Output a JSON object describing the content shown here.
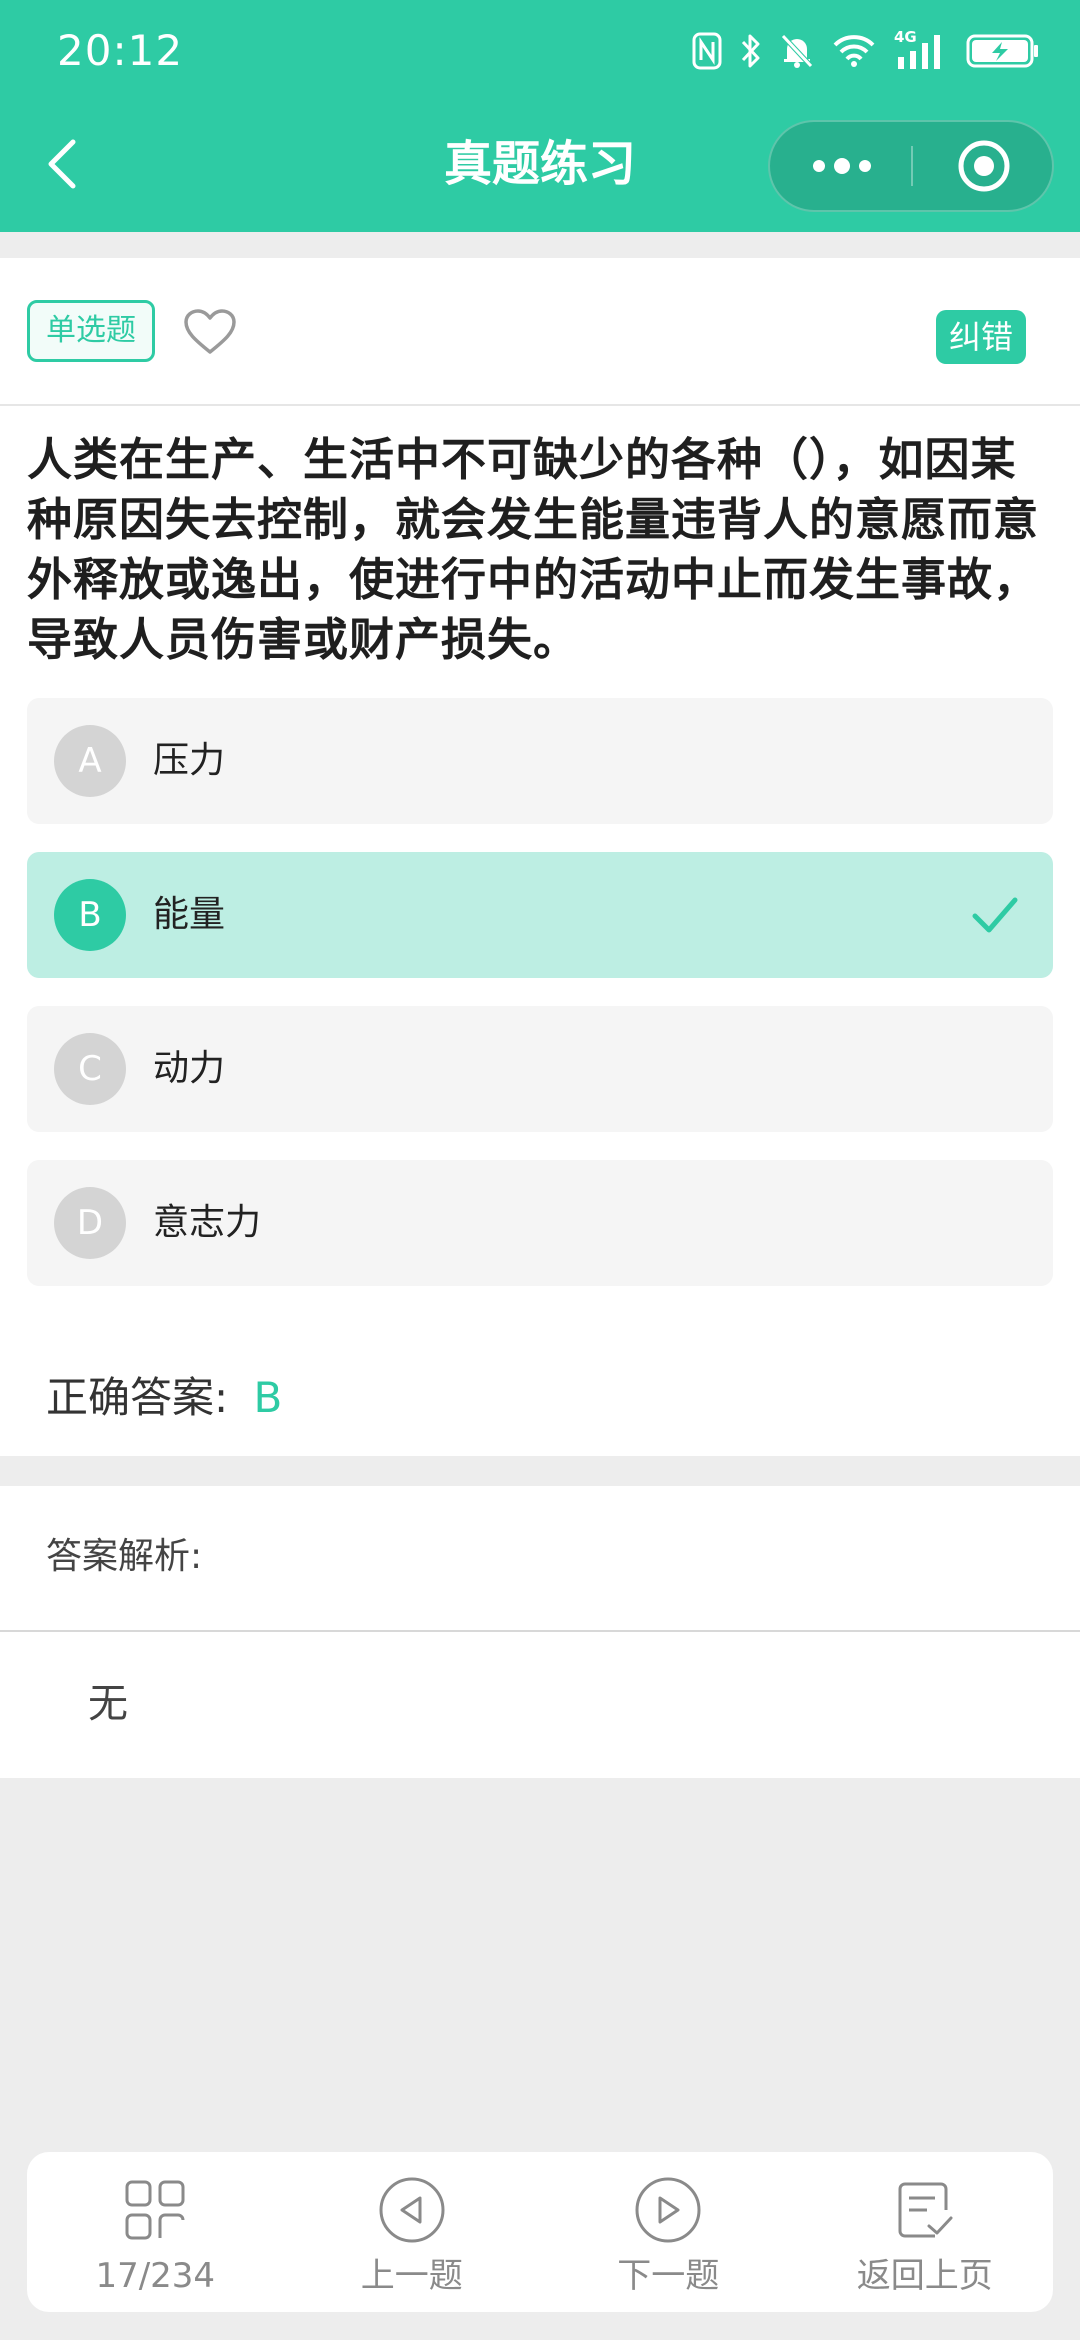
{
  "status_bar": {
    "time": "20:12",
    "icons": [
      "nfc-icon",
      "bluetooth-icon",
      "bell-off-icon",
      "wifi-icon",
      "4g-signal-icon",
      "battery-charging-icon"
    ],
    "network_label": "4G"
  },
  "nav": {
    "title": "真题练习",
    "back_icon": "chevron-left-icon",
    "more_icon": "more-dots-icon",
    "close_icon": "target-circle-icon"
  },
  "question": {
    "type_tag": "单选题",
    "favorite_icon": "heart-outline-icon",
    "report_label": "纠错",
    "text": "人类在生产、生活中不可缺少的各种（），如因某种原因失去控制，就会发生能量违背人的意愿而意外释放或逸出，使进行中的活动中止而发生事故，导致人员伤害或财产损失。",
    "options": [
      {
        "letter": "A",
        "text": "压力",
        "selected": false
      },
      {
        "letter": "B",
        "text": "能量",
        "selected": true
      },
      {
        "letter": "C",
        "text": "动力",
        "selected": false
      },
      {
        "letter": "D",
        "text": "意志力",
        "selected": false
      }
    ],
    "answer_label": "正确答案:",
    "answer_value": "B"
  },
  "analysis": {
    "title": "答案解析:",
    "body": "无"
  },
  "bottom_bar": {
    "items": [
      {
        "label": "17/234",
        "icon": "grid-icon"
      },
      {
        "label": "上一题",
        "icon": "prev-circle-icon"
      },
      {
        "label": "下一题",
        "icon": "next-circle-icon"
      },
      {
        "label": "返回上页",
        "icon": "checklist-icon"
      }
    ]
  },
  "colors": {
    "accent": "#2ecba4",
    "selected_bg": "#bdeee3",
    "page_bg": "#ededed",
    "option_bg": "#f5f5f5"
  }
}
